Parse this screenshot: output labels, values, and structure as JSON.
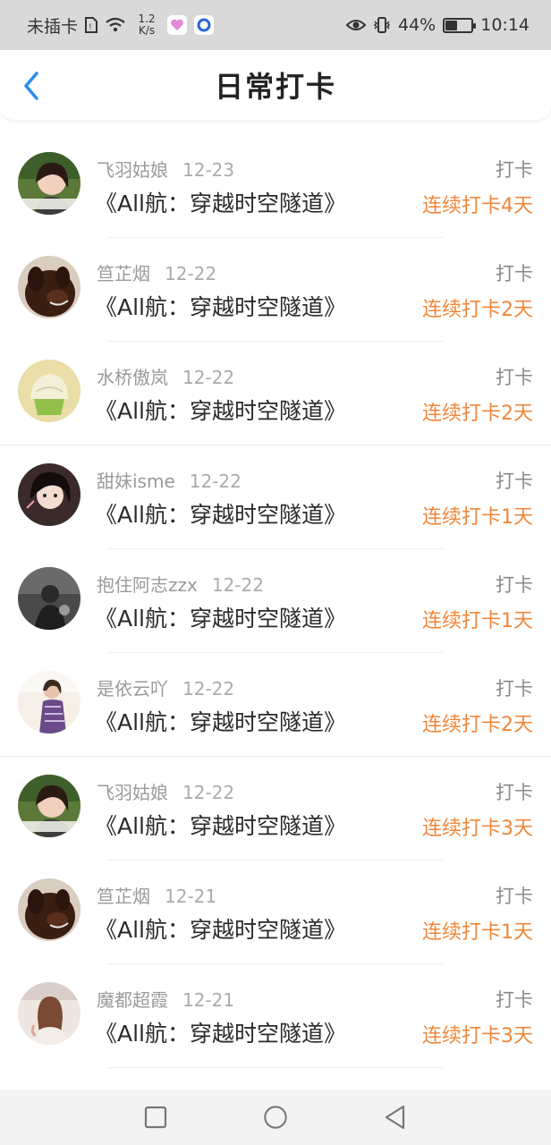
{
  "status_bar": {
    "carrier": "未插卡",
    "speed": "1.2 K/s",
    "battery": "44%",
    "battery_level": 0.44,
    "time": "10:14",
    "icons": [
      "sim-icon",
      "wifi-icon",
      "app-icon-1",
      "app-icon-2",
      "eye-icon",
      "vibrate-icon",
      "battery-icon"
    ]
  },
  "header": {
    "title": "日常打卡",
    "back_icon": "chevron-left-icon",
    "accent": "#2d8cf0"
  },
  "colors": {
    "streak": "#f0873a",
    "meta": "#9a9a9a"
  },
  "items": [
    {
      "name": "飞羽姑娘",
      "date": "12-23",
      "book": "《All航：穿越时空隧道》",
      "action": "打卡",
      "streak": "连续打卡4天",
      "avatar": "girl-green-avatar"
    },
    {
      "name": "笪芷烟",
      "date": "12-22",
      "book": "《All航：穿越时空隧道》",
      "action": "打卡",
      "streak": "连续打卡2天",
      "avatar": "dog-avatar"
    },
    {
      "name": "水桥傲岚",
      "date": "12-22",
      "book": "《All航：穿越时空隧道》",
      "action": "打卡",
      "streak": "连续打卡2天",
      "avatar": "cupcake-avatar"
    },
    {
      "name": "甜妹isme",
      "date": "12-22",
      "book": "《All航：穿越时空隧道》",
      "action": "打卡",
      "streak": "连续打卡1天",
      "avatar": "girl-dark-avatar"
    },
    {
      "name": "抱住阿志zzx",
      "date": "12-22",
      "book": "《All航：穿越时空隧道》",
      "action": "打卡",
      "streak": "连续打卡1天",
      "avatar": "gray-photo-avatar"
    },
    {
      "name": "是依云吖",
      "date": "12-22",
      "book": "《All航：穿越时空隧道》",
      "action": "打卡",
      "streak": "连续打卡2天",
      "avatar": "person-purple-avatar"
    },
    {
      "name": "飞羽姑娘",
      "date": "12-22",
      "book": "《All航：穿越时空隧道》",
      "action": "打卡",
      "streak": "连续打卡3天",
      "avatar": "girl-green-avatar"
    },
    {
      "name": "笪芷烟",
      "date": "12-21",
      "book": "《All航：穿越时空隧道》",
      "action": "打卡",
      "streak": "连续打卡1天",
      "avatar": "dog-avatar"
    },
    {
      "name": "魔都超霞",
      "date": "12-21",
      "book": "《All航：穿越时空隧道》",
      "action": "打卡",
      "streak": "连续打卡3天",
      "avatar": "girl-back-avatar"
    }
  ],
  "nav_bar": {
    "icons": [
      "recent-apps-icon",
      "home-icon",
      "back-icon"
    ]
  }
}
